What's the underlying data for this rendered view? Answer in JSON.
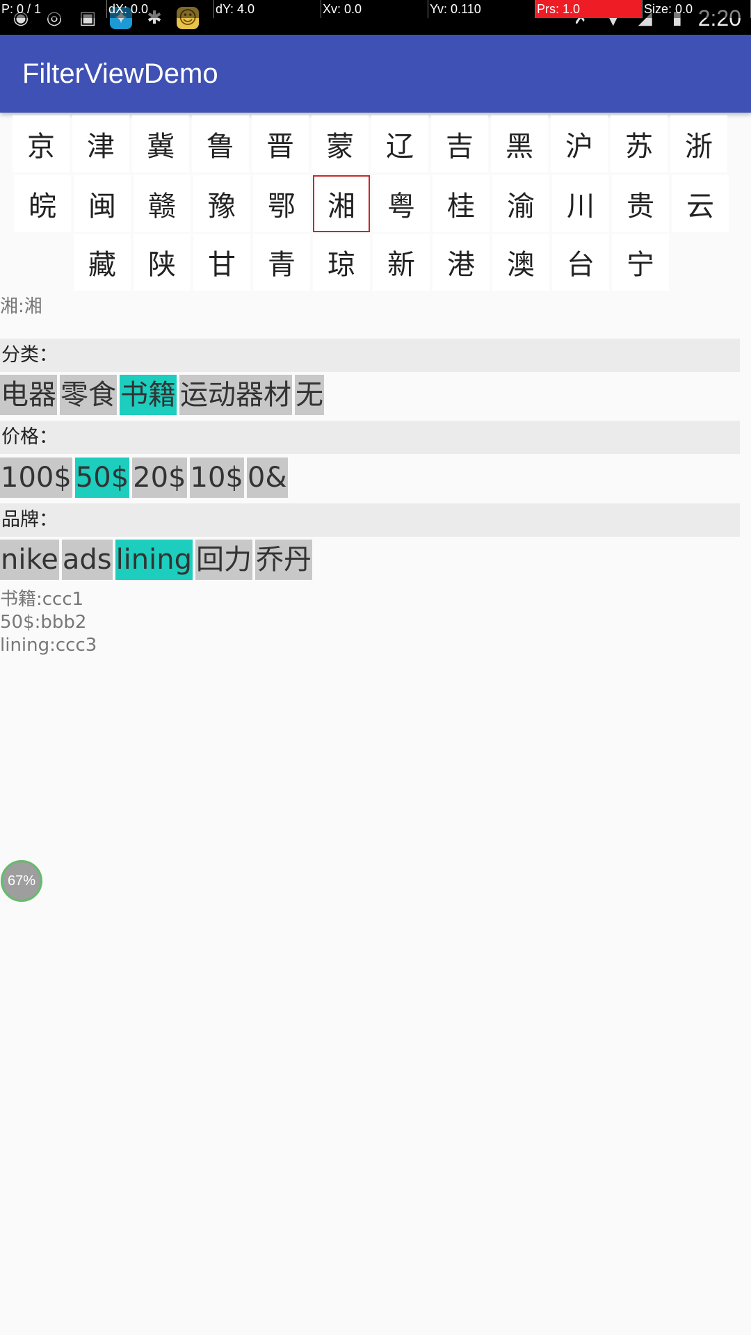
{
  "status_bar": {
    "debug": [
      "P: 0 / 1",
      "dX: 0.0",
      "dY: 4.0",
      "Xv: 0.0",
      "Yv: 0.110",
      "Prs: 1.0",
      "Size: 0.0"
    ],
    "time": "2:20"
  },
  "app_bar": {
    "title": "FilterViewDemo"
  },
  "provinces": {
    "row1": [
      "京",
      "津",
      "冀",
      "鲁",
      "晋",
      "蒙",
      "辽",
      "吉",
      "黑",
      "沪",
      "苏",
      "浙"
    ],
    "row2": [
      "皖",
      "闽",
      "赣",
      "豫",
      "鄂",
      "湘",
      "粤",
      "桂",
      "渝",
      "川",
      "贵",
      "云"
    ],
    "row3": [
      "藏",
      "陕",
      "甘",
      "青",
      "琼",
      "新",
      "港",
      "澳",
      "台",
      "宁"
    ],
    "selected": "湘"
  },
  "province_result": "湘:湘",
  "filters": {
    "category": {
      "header": "分类：",
      "options": [
        "电器",
        "零食",
        "书籍",
        "运动器材",
        "无"
      ],
      "selected": "书籍"
    },
    "price": {
      "header": "价格：",
      "options": [
        "100$",
        "50$",
        "20$",
        "10$",
        "0&"
      ],
      "selected": "50$"
    },
    "brand": {
      "header": "品牌：",
      "options": [
        "nike",
        "ads",
        "lining",
        "回力",
        "乔丹"
      ],
      "selected": "lining"
    }
  },
  "summary_lines": [
    "书籍:ccc1",
    "50$:bbb2",
    "lining:ccc3"
  ],
  "floating_badge": "67%"
}
